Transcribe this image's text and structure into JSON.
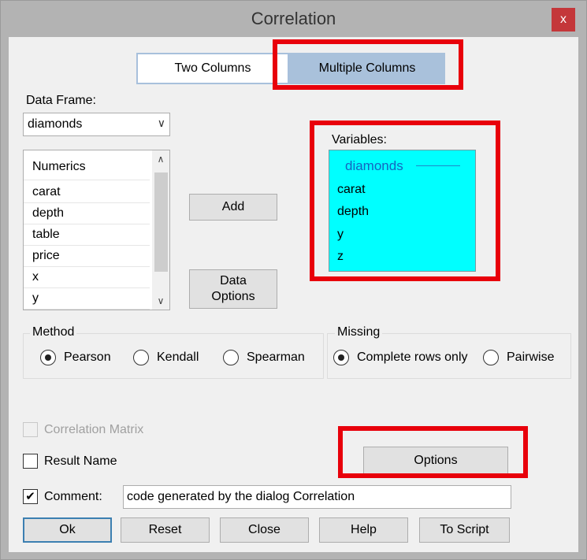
{
  "window": {
    "title": "Correlation",
    "close_glyph": "x"
  },
  "mode_tabs": {
    "two_columns": "Two Columns",
    "multiple_columns": "Multiple Columns",
    "selected": "multiple_columns"
  },
  "data_frame": {
    "label": "Data Frame:",
    "value": "diamonds"
  },
  "source_list": {
    "header": "Numerics",
    "items": [
      "carat",
      "depth",
      "table",
      "price",
      "x",
      "y"
    ]
  },
  "buttons": {
    "add": "Add",
    "data_options_line1": "Data",
    "data_options_line2": "Options",
    "options": "Options",
    "ok": "Ok",
    "reset": "Reset",
    "close": "Close",
    "help": "Help",
    "to_script": "To Script"
  },
  "variables": {
    "label": "Variables:",
    "group": "diamonds",
    "items": [
      "carat",
      "depth",
      "y",
      "z"
    ],
    "background": "#00ffff"
  },
  "method": {
    "title": "Method",
    "options": [
      "Pearson",
      "Kendall",
      "Spearman"
    ],
    "selected": "Pearson"
  },
  "missing": {
    "title": "Missing",
    "options": [
      "Complete rows only",
      "Pairwise"
    ],
    "selected": "Complete rows only"
  },
  "checks": {
    "correlation_matrix": "Correlation Matrix",
    "result_name": "Result Name",
    "comment": "Comment:",
    "comment_checked_glyph": "✔"
  },
  "comment_value": "code generated by the dialog Correlation",
  "colors": {
    "highlight": "#e8000b",
    "title_bar": "#b3b3b3",
    "close_button": "#c4373a"
  }
}
